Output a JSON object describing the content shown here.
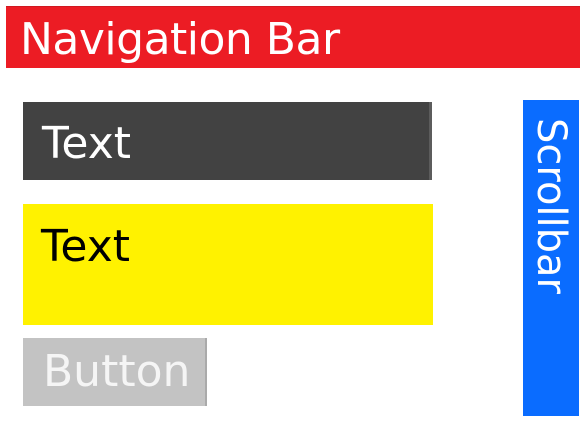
{
  "navigation_bar": {
    "label": "Navigation Bar",
    "color": "#ec1c24"
  },
  "text_block_dark": {
    "label": "Text",
    "color": "#424242"
  },
  "text_block_yellow": {
    "label": "Text",
    "color": "#fff200"
  },
  "button": {
    "label": "Button",
    "color": "#c3c3c3"
  },
  "scrollbar": {
    "label": "Scrollbar",
    "color": "#0a6cff"
  }
}
